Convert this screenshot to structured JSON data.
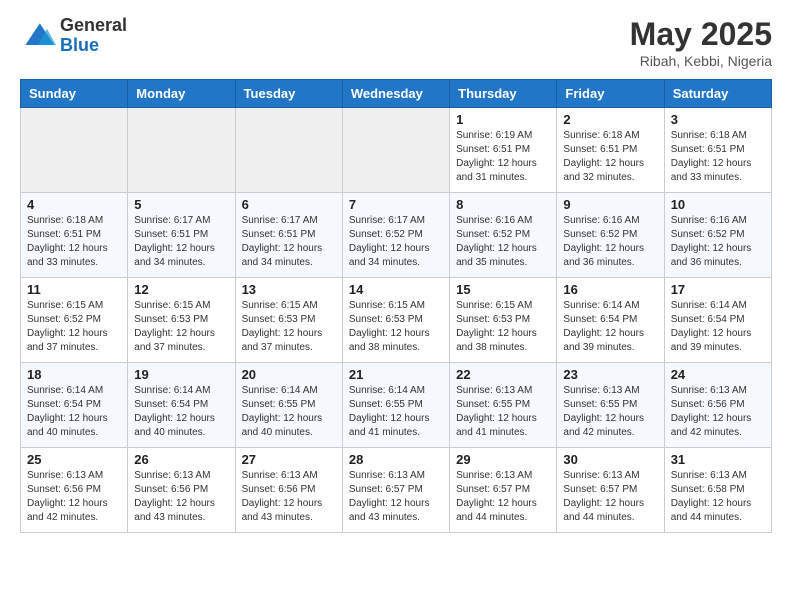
{
  "logo": {
    "general": "General",
    "blue": "Blue"
  },
  "title": "May 2025",
  "location": "Ribah, Kebbi, Nigeria",
  "days_header": [
    "Sunday",
    "Monday",
    "Tuesday",
    "Wednesday",
    "Thursday",
    "Friday",
    "Saturday"
  ],
  "weeks": [
    [
      {
        "num": "",
        "info": ""
      },
      {
        "num": "",
        "info": ""
      },
      {
        "num": "",
        "info": ""
      },
      {
        "num": "",
        "info": ""
      },
      {
        "num": "1",
        "info": "Sunrise: 6:19 AM\nSunset: 6:51 PM\nDaylight: 12 hours\nand 31 minutes."
      },
      {
        "num": "2",
        "info": "Sunrise: 6:18 AM\nSunset: 6:51 PM\nDaylight: 12 hours\nand 32 minutes."
      },
      {
        "num": "3",
        "info": "Sunrise: 6:18 AM\nSunset: 6:51 PM\nDaylight: 12 hours\nand 33 minutes."
      }
    ],
    [
      {
        "num": "4",
        "info": "Sunrise: 6:18 AM\nSunset: 6:51 PM\nDaylight: 12 hours\nand 33 minutes."
      },
      {
        "num": "5",
        "info": "Sunrise: 6:17 AM\nSunset: 6:51 PM\nDaylight: 12 hours\nand 34 minutes."
      },
      {
        "num": "6",
        "info": "Sunrise: 6:17 AM\nSunset: 6:51 PM\nDaylight: 12 hours\nand 34 minutes."
      },
      {
        "num": "7",
        "info": "Sunrise: 6:17 AM\nSunset: 6:52 PM\nDaylight: 12 hours\nand 34 minutes."
      },
      {
        "num": "8",
        "info": "Sunrise: 6:16 AM\nSunset: 6:52 PM\nDaylight: 12 hours\nand 35 minutes."
      },
      {
        "num": "9",
        "info": "Sunrise: 6:16 AM\nSunset: 6:52 PM\nDaylight: 12 hours\nand 36 minutes."
      },
      {
        "num": "10",
        "info": "Sunrise: 6:16 AM\nSunset: 6:52 PM\nDaylight: 12 hours\nand 36 minutes."
      }
    ],
    [
      {
        "num": "11",
        "info": "Sunrise: 6:15 AM\nSunset: 6:52 PM\nDaylight: 12 hours\nand 37 minutes."
      },
      {
        "num": "12",
        "info": "Sunrise: 6:15 AM\nSunset: 6:53 PM\nDaylight: 12 hours\nand 37 minutes."
      },
      {
        "num": "13",
        "info": "Sunrise: 6:15 AM\nSunset: 6:53 PM\nDaylight: 12 hours\nand 37 minutes."
      },
      {
        "num": "14",
        "info": "Sunrise: 6:15 AM\nSunset: 6:53 PM\nDaylight: 12 hours\nand 38 minutes."
      },
      {
        "num": "15",
        "info": "Sunrise: 6:15 AM\nSunset: 6:53 PM\nDaylight: 12 hours\nand 38 minutes."
      },
      {
        "num": "16",
        "info": "Sunrise: 6:14 AM\nSunset: 6:54 PM\nDaylight: 12 hours\nand 39 minutes."
      },
      {
        "num": "17",
        "info": "Sunrise: 6:14 AM\nSunset: 6:54 PM\nDaylight: 12 hours\nand 39 minutes."
      }
    ],
    [
      {
        "num": "18",
        "info": "Sunrise: 6:14 AM\nSunset: 6:54 PM\nDaylight: 12 hours\nand 40 minutes."
      },
      {
        "num": "19",
        "info": "Sunrise: 6:14 AM\nSunset: 6:54 PM\nDaylight: 12 hours\nand 40 minutes."
      },
      {
        "num": "20",
        "info": "Sunrise: 6:14 AM\nSunset: 6:55 PM\nDaylight: 12 hours\nand 40 minutes."
      },
      {
        "num": "21",
        "info": "Sunrise: 6:14 AM\nSunset: 6:55 PM\nDaylight: 12 hours\nand 41 minutes."
      },
      {
        "num": "22",
        "info": "Sunrise: 6:13 AM\nSunset: 6:55 PM\nDaylight: 12 hours\nand 41 minutes."
      },
      {
        "num": "23",
        "info": "Sunrise: 6:13 AM\nSunset: 6:55 PM\nDaylight: 12 hours\nand 42 minutes."
      },
      {
        "num": "24",
        "info": "Sunrise: 6:13 AM\nSunset: 6:56 PM\nDaylight: 12 hours\nand 42 minutes."
      }
    ],
    [
      {
        "num": "25",
        "info": "Sunrise: 6:13 AM\nSunset: 6:56 PM\nDaylight: 12 hours\nand 42 minutes."
      },
      {
        "num": "26",
        "info": "Sunrise: 6:13 AM\nSunset: 6:56 PM\nDaylight: 12 hours\nand 43 minutes."
      },
      {
        "num": "27",
        "info": "Sunrise: 6:13 AM\nSunset: 6:56 PM\nDaylight: 12 hours\nand 43 minutes."
      },
      {
        "num": "28",
        "info": "Sunrise: 6:13 AM\nSunset: 6:57 PM\nDaylight: 12 hours\nand 43 minutes."
      },
      {
        "num": "29",
        "info": "Sunrise: 6:13 AM\nSunset: 6:57 PM\nDaylight: 12 hours\nand 44 minutes."
      },
      {
        "num": "30",
        "info": "Sunrise: 6:13 AM\nSunset: 6:57 PM\nDaylight: 12 hours\nand 44 minutes."
      },
      {
        "num": "31",
        "info": "Sunrise: 6:13 AM\nSunset: 6:58 PM\nDaylight: 12 hours\nand 44 minutes."
      }
    ]
  ]
}
